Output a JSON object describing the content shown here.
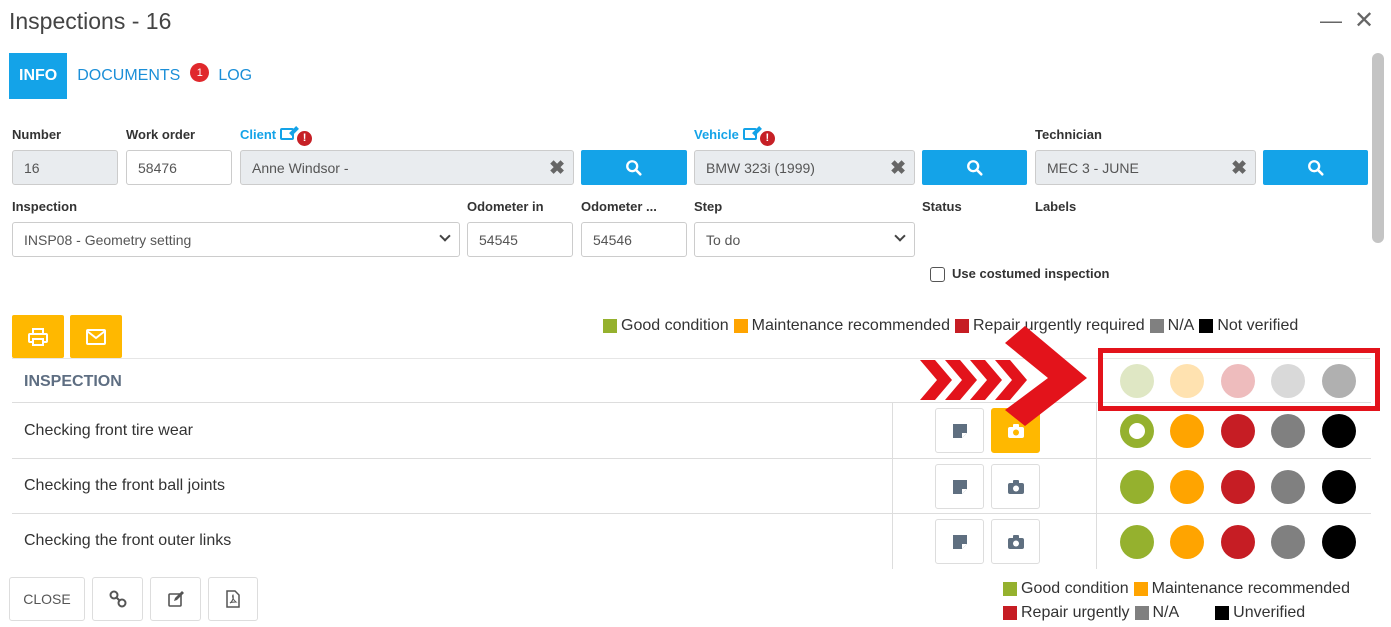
{
  "window": {
    "title": "Inspections - 16"
  },
  "tabs": [
    {
      "label": "INFO",
      "active": true
    },
    {
      "label": "DOCUMENTS",
      "badge": "1"
    },
    {
      "label": "LOG"
    }
  ],
  "form": {
    "number": {
      "label": "Number",
      "value": "16"
    },
    "work_order": {
      "label": "Work order",
      "value": "58476"
    },
    "client": {
      "label": "Client",
      "value": "Anne Windsor -"
    },
    "vehicle": {
      "label": "Vehicle",
      "value": "BMW 323i (1999)"
    },
    "technician": {
      "label": "Technician",
      "value": "MEC 3 - JUNE"
    },
    "inspection": {
      "label": "Inspection",
      "value": "INSP08 - Geometry setting"
    },
    "odometer_in": {
      "label": "Odometer in",
      "value": "54545"
    },
    "odometer_out": {
      "label": "Odometer ...",
      "value": "54546"
    },
    "step": {
      "label": "Step",
      "value": "To do"
    },
    "status": {
      "label": "Status"
    },
    "labels": {
      "label": "Labels"
    },
    "custom": {
      "label": "Use costumed inspection",
      "checked": false
    }
  },
  "legend_top": [
    {
      "label": "Good condition",
      "color": "#95b12e"
    },
    {
      "label": "Maintenance recommended",
      "color": "#ffa400"
    },
    {
      "label": "Repair urgently required",
      "color": "#c61d24"
    },
    {
      "label": "N/A",
      "color": "#808080"
    },
    {
      "label": "Not verified",
      "color": "#000000"
    }
  ],
  "table": {
    "header": "INSPECTION",
    "header_dots": [
      "#dfe7c4",
      "#ffe2b0",
      "#eebcbd",
      "#d9d9d9",
      "#b0b0b0"
    ],
    "rows": [
      {
        "name": "Checking front tire wear",
        "selected": 0,
        "photo_active": true
      },
      {
        "name": "Checking the front ball joints",
        "selected": null,
        "photo_active": false
      },
      {
        "name": "Checking the front outer links",
        "selected": null,
        "photo_active": false
      }
    ],
    "dot_colors": [
      "#95b12e",
      "#ffa400",
      "#c61d24",
      "#808080",
      "#000000"
    ]
  },
  "footer": {
    "close_label": "CLOSE",
    "legend": [
      {
        "label": "Good condition",
        "color": "#95b12e"
      },
      {
        "label": "Maintenance recommended",
        "color": "#ffa400"
      },
      {
        "label": "Repair urgently",
        "color": "#c61d24"
      },
      {
        "label": "N/A",
        "color": "#808080"
      },
      {
        "label": "Unverified",
        "color": "#000000"
      }
    ]
  },
  "icons": {
    "minimize": "minimize-icon",
    "close": "close-icon",
    "search": "search-icon",
    "clear": "clear-icon",
    "printer": "printer-icon",
    "mail": "mail-icon",
    "note": "note-icon",
    "camera": "camera-icon",
    "link": "link-icon",
    "edit": "edit-icon",
    "pdf": "pdf-icon"
  },
  "colors": {
    "accent": "#14a3e8",
    "warning": "#ffb800",
    "annotation": "#e3131b"
  }
}
